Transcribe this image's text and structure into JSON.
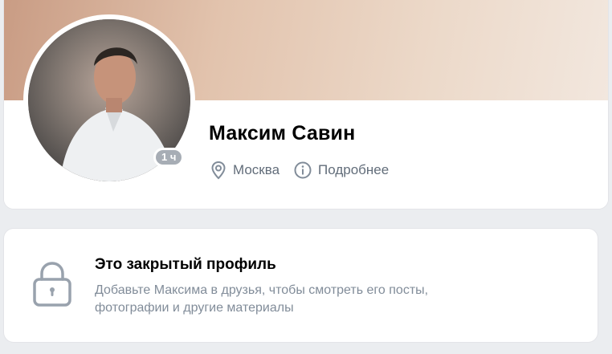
{
  "profile": {
    "name": "Максим Савин",
    "online_badge": "1 ч",
    "location": "Москва",
    "details_link": "Подробнее"
  },
  "private_notice": {
    "title": "Это закрытый профиль",
    "description": "Добавьте Максима в друзья, чтобы смотреть его посты, фотографии и другие материалы"
  },
  "colors": {
    "background": "#ebedf0",
    "card": "#ffffff",
    "secondary_text": "#626d7a",
    "muted_text": "#818c99",
    "badge": "#a7adb5",
    "icon": "#99a2ad"
  },
  "icons": {
    "location": "location-pin-icon",
    "details": "info-circle-icon",
    "private": "lock-icon"
  }
}
